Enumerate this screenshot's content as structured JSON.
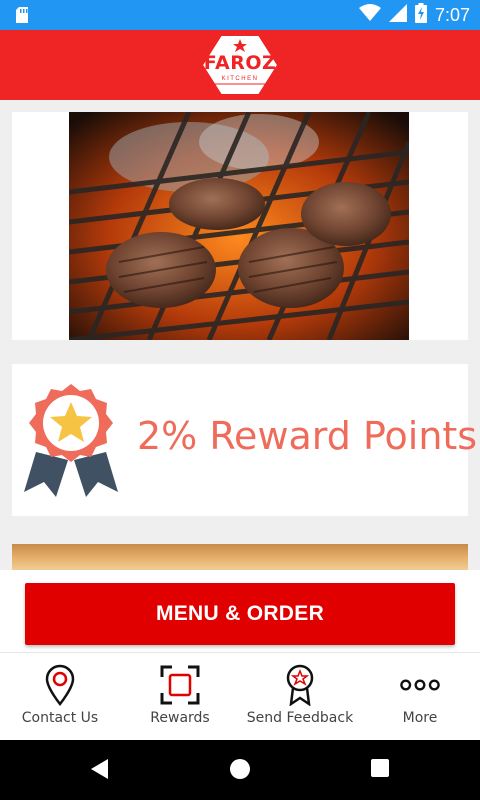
{
  "status_bar": {
    "time": "7:07",
    "icons": [
      "sd-card-icon",
      "wifi-icon",
      "signal-icon",
      "battery-charging-icon"
    ]
  },
  "header": {
    "logo_text": "FAROZ",
    "logo_subtext": "KITCHEN",
    "brand_color": "#ef2424"
  },
  "cards": {
    "grill": {
      "image": "burger-patties-on-grill"
    },
    "reward": {
      "text": "2% Reward Points",
      "icon": "award-medal-star-icon"
    },
    "beach": {
      "image": "beach-sunset-partial"
    }
  },
  "menu_button": {
    "label": "MENU & ORDER",
    "color": "#e00000"
  },
  "bottom_nav": {
    "items": [
      {
        "label": "Contact Us",
        "icon": "location-pin-icon"
      },
      {
        "label": "Rewards",
        "icon": "rewards-frame-icon"
      },
      {
        "label": "Send Feedback",
        "icon": "feedback-medal-icon"
      },
      {
        "label": "More",
        "icon": "more-dots-icon"
      }
    ]
  },
  "android_nav": {
    "buttons": [
      "back-icon",
      "home-icon",
      "recents-icon"
    ]
  }
}
